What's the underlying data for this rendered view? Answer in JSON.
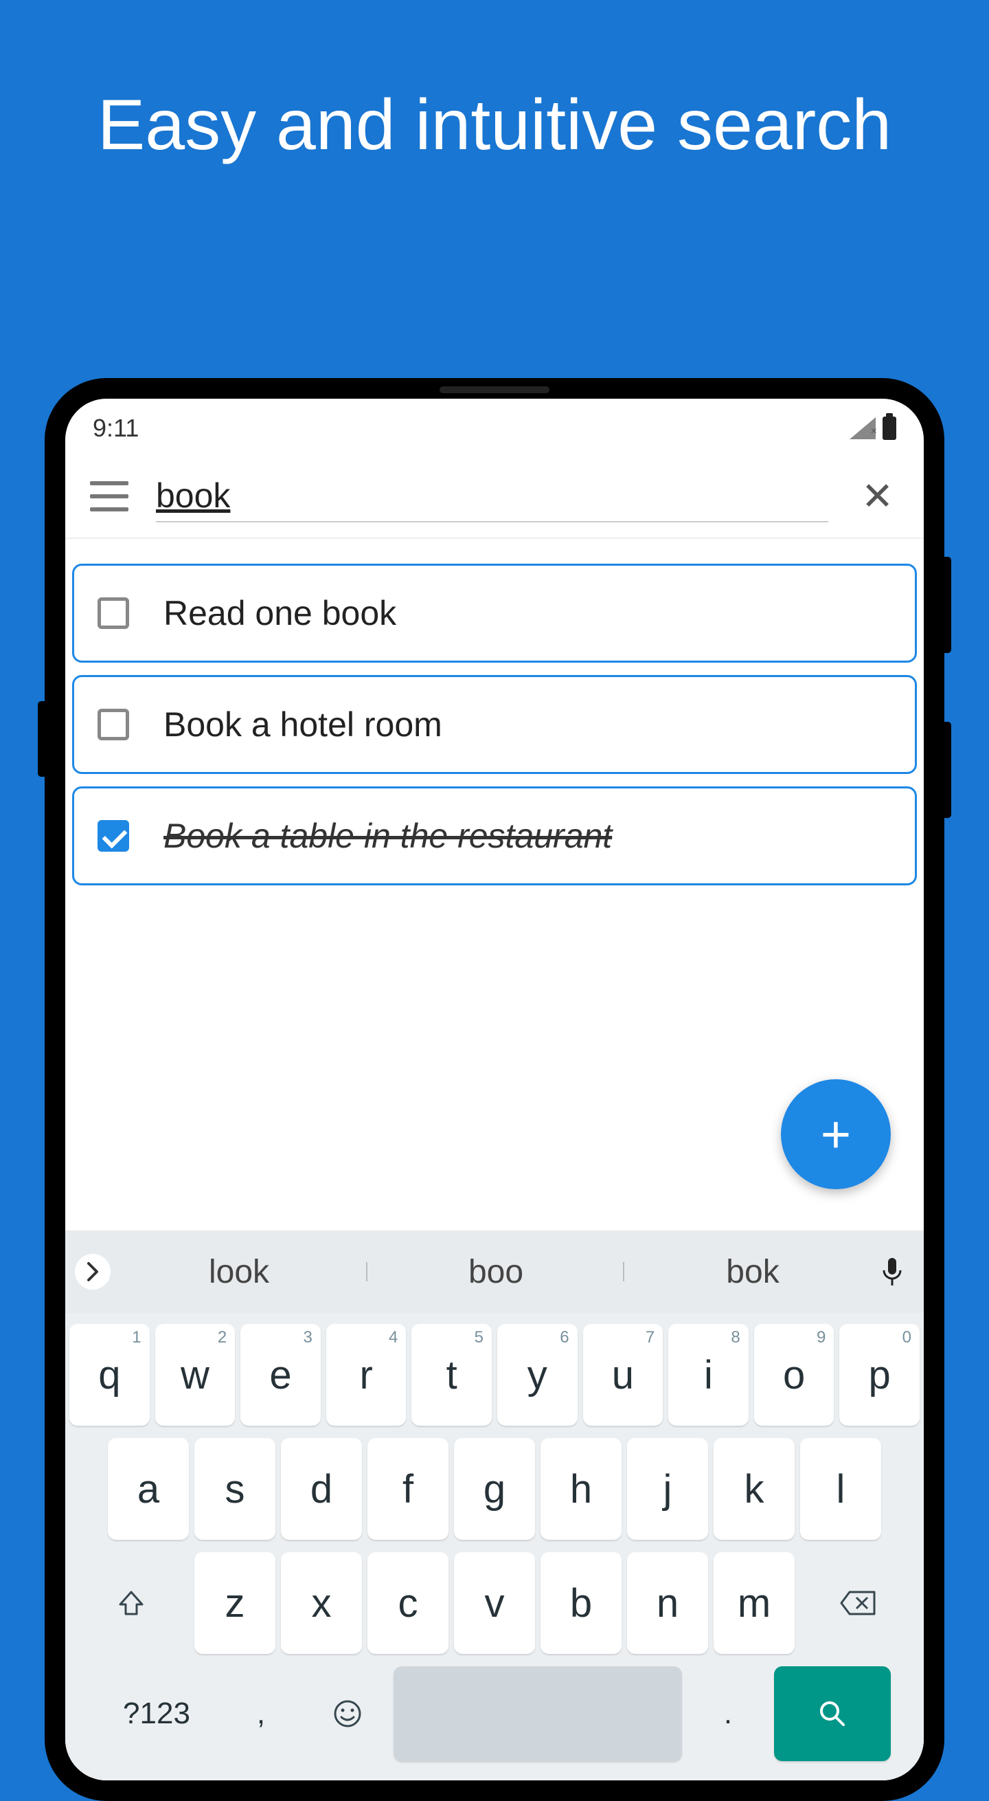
{
  "hero": {
    "title": "Easy and intuitive search"
  },
  "status": {
    "time": "9:11"
  },
  "search": {
    "value": "book"
  },
  "tasks": [
    {
      "label": "Read one book",
      "done": false
    },
    {
      "label": "Book a hotel room",
      "done": false
    },
    {
      "label": "Book a table in the restaurant",
      "done": true
    }
  ],
  "fab": {
    "glyph": "+"
  },
  "keyboard": {
    "suggestions": [
      "look",
      "boo",
      "bok"
    ],
    "row1": [
      {
        "k": "q",
        "n": "1"
      },
      {
        "k": "w",
        "n": "2"
      },
      {
        "k": "e",
        "n": "3"
      },
      {
        "k": "r",
        "n": "4"
      },
      {
        "k": "t",
        "n": "5"
      },
      {
        "k": "y",
        "n": "6"
      },
      {
        "k": "u",
        "n": "7"
      },
      {
        "k": "i",
        "n": "8"
      },
      {
        "k": "o",
        "n": "9"
      },
      {
        "k": "p",
        "n": "0"
      }
    ],
    "row2": [
      "a",
      "s",
      "d",
      "f",
      "g",
      "h",
      "j",
      "k",
      "l"
    ],
    "row3": [
      "z",
      "x",
      "c",
      "v",
      "b",
      "n",
      "m"
    ],
    "bottom": {
      "symbols": "?123",
      "comma": ",",
      "period": "."
    }
  }
}
